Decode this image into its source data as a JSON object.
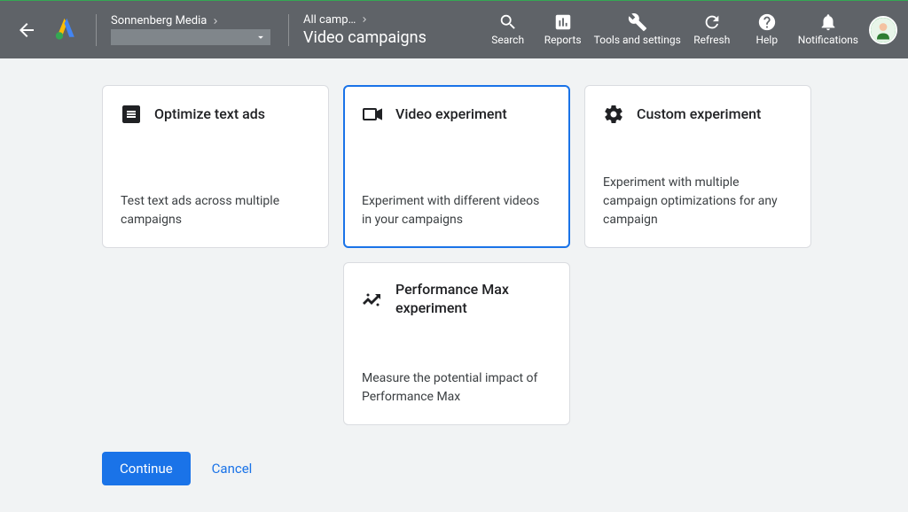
{
  "header": {
    "account": "Sonnenberg Media",
    "campaigns_short": "All camp…",
    "campaign_type": "Video campaigns",
    "actions": {
      "search": "Search",
      "reports": "Reports",
      "tools": "Tools and settings",
      "refresh": "Refresh",
      "help": "Help",
      "notifications": "Notifications"
    }
  },
  "cards": {
    "optimize": {
      "title": "Optimize text ads",
      "desc": "Test text ads across multiple campaigns"
    },
    "video": {
      "title": "Video experiment",
      "desc": "Experiment with different videos in your campaigns"
    },
    "custom": {
      "title": "Custom experiment",
      "desc": "Experiment with multiple campaign optimizations for any campaign"
    },
    "pmax": {
      "title": "Performance Max experiment",
      "desc": "Measure the potential impact of Performance Max"
    }
  },
  "buttons": {
    "continue": "Continue",
    "cancel": "Cancel"
  }
}
